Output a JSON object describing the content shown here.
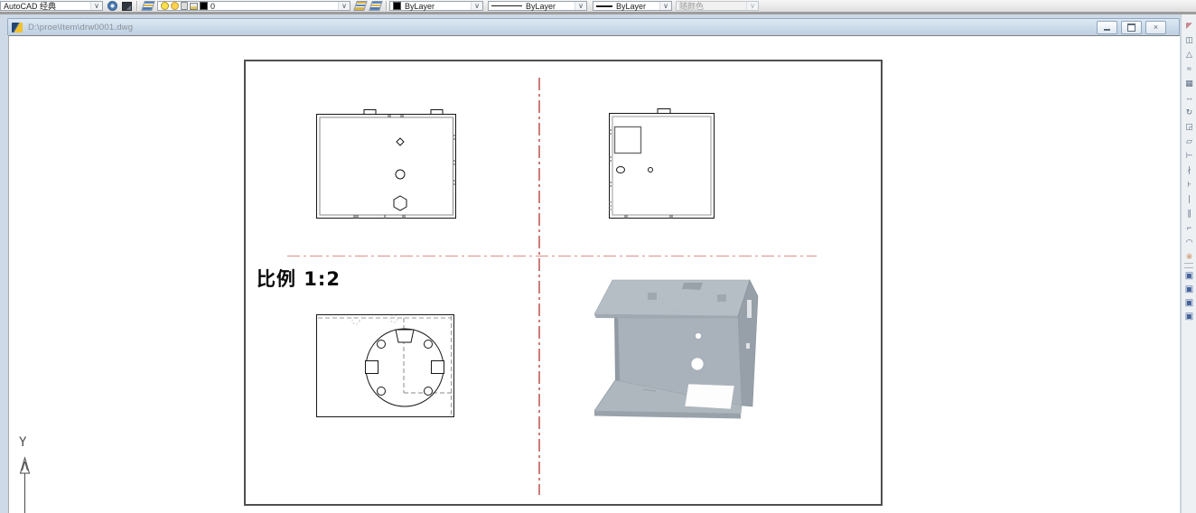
{
  "top_toolbar": {
    "chevron_glyph": "∨",
    "workspace_combo": {
      "value": "AutoCAD 经典"
    },
    "layer_combo": {
      "current_layer": "0"
    },
    "color_combo": {
      "value": "ByLayer"
    },
    "linetype_combo": {
      "value": "ByLayer"
    },
    "lineweight_combo": {
      "value": "ByLayer"
    },
    "plot_style_combo": {
      "value": "随颜色"
    }
  },
  "document_window": {
    "title": "D:\\proe\\Item\\drw0001.dwg",
    "close_glyph": "×"
  },
  "drawing": {
    "scale_label": "比例 1:2",
    "ucs_y_label": "Y"
  },
  "right_toolbar": {
    "modify_icons": [
      {
        "name": "erase-icon",
        "glyph": "◤",
        "color": "#c9868c"
      },
      {
        "name": "copy-icon",
        "glyph": "◫"
      },
      {
        "name": "mirror-icon",
        "glyph": "△"
      },
      {
        "name": "offset-icon",
        "glyph": "≈"
      },
      {
        "name": "array-icon",
        "glyph": "▦"
      },
      {
        "name": "move-icon",
        "glyph": "↔"
      },
      {
        "name": "rotate-icon",
        "glyph": "↻"
      },
      {
        "name": "scale-icon",
        "glyph": "◲"
      },
      {
        "name": "stretch-icon",
        "glyph": "▱"
      },
      {
        "name": "lengthen-icon",
        "glyph": "⊢"
      },
      {
        "name": "trim-icon",
        "glyph": "∤"
      },
      {
        "name": "extend-icon",
        "glyph": "⊦"
      },
      {
        "name": "break-at-point-icon",
        "glyph": "∣"
      },
      {
        "name": "break-icon",
        "glyph": "∥"
      },
      {
        "name": "chamfer-icon",
        "glyph": "⌐"
      },
      {
        "name": "fillet-icon",
        "glyph": "◠"
      },
      {
        "name": "explode-icon",
        "glyph": "※",
        "color": "#c87f4a"
      }
    ],
    "viewport_icons": [
      {
        "name": "named-views-icon",
        "glyph": "▣"
      },
      {
        "name": "single-viewport-icon",
        "glyph": "▣"
      },
      {
        "name": "polygonal-viewport-icon",
        "glyph": "▣"
      },
      {
        "name": "clip-viewport-icon",
        "glyph": "▣"
      }
    ]
  },
  "colors": {
    "centerline_red": "#b23530",
    "centerline_pink": "#e79b96",
    "model_gray": "#a9b2ba",
    "titlebar_top": "#dde8f3",
    "titlebar_bottom": "#bdd0e3"
  }
}
